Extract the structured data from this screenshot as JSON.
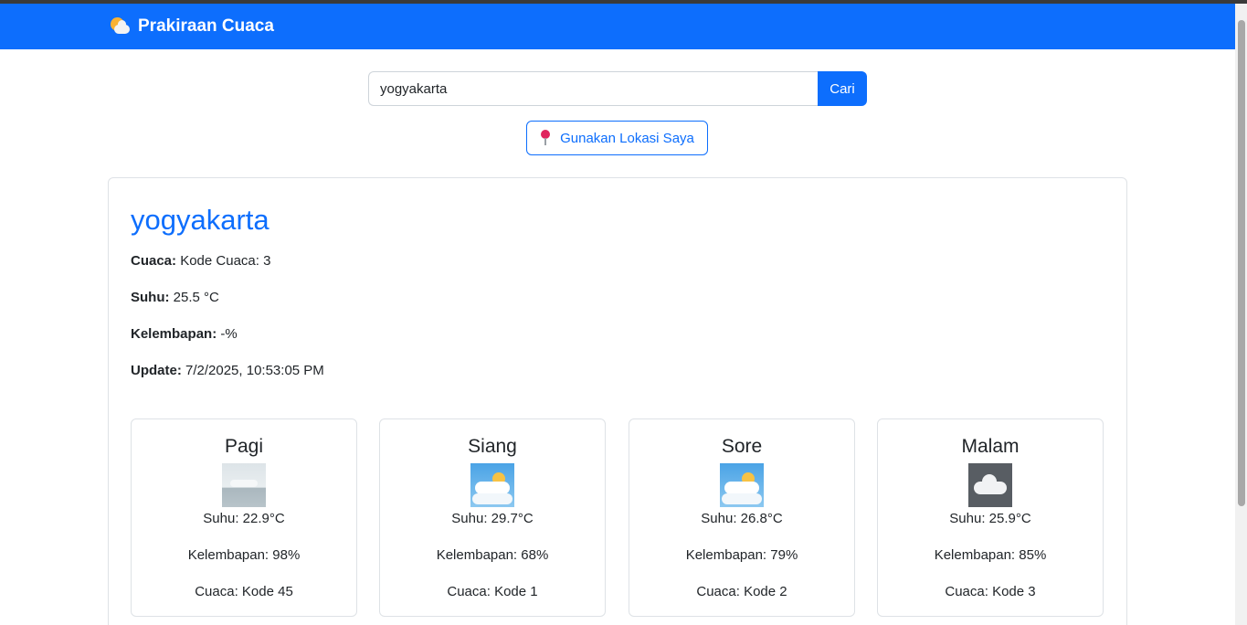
{
  "app": {
    "title": "Prakiraan Cuaca",
    "icon": "sun-behind-cloud-icon"
  },
  "search": {
    "value": "yogyakarta",
    "button_label": "Cari"
  },
  "location_button": {
    "label": "Gunakan Lokasi Saya",
    "icon": "round-pushpin-icon"
  },
  "current": {
    "city": "yogyakarta",
    "weather_label": "Cuaca:",
    "weather_value": "Kode Cuaca: 3",
    "temp_label": "Suhu:",
    "temp_value": "25.5 °C",
    "humidity_label": "Kelembapan:",
    "humidity_value": "-%",
    "update_label": "Update:",
    "update_value": "7/2/2025, 10:53:05 PM"
  },
  "periods": [
    {
      "name": "Pagi",
      "icon": "fog-icon",
      "temp": "Suhu: 22.9°C",
      "humidity": "Kelembapan: 98%",
      "weather": "Cuaca: Kode 45"
    },
    {
      "name": "Siang",
      "icon": "sun-behind-cloud-icon",
      "temp": "Suhu: 29.7°C",
      "humidity": "Kelembapan: 68%",
      "weather": "Cuaca: Kode 1"
    },
    {
      "name": "Sore",
      "icon": "sun-behind-cloud-icon",
      "temp": "Suhu: 26.8°C",
      "humidity": "Kelembapan: 79%",
      "weather": "Cuaca: Kode 2"
    },
    {
      "name": "Malam",
      "icon": "cloud-icon",
      "temp": "Suhu: 25.9°C",
      "humidity": "Kelembapan: 85%",
      "weather": "Cuaca: Kode 3"
    }
  ],
  "colors": {
    "primary": "#0d6efd",
    "text": "#212529",
    "border": "#dee2e6"
  }
}
